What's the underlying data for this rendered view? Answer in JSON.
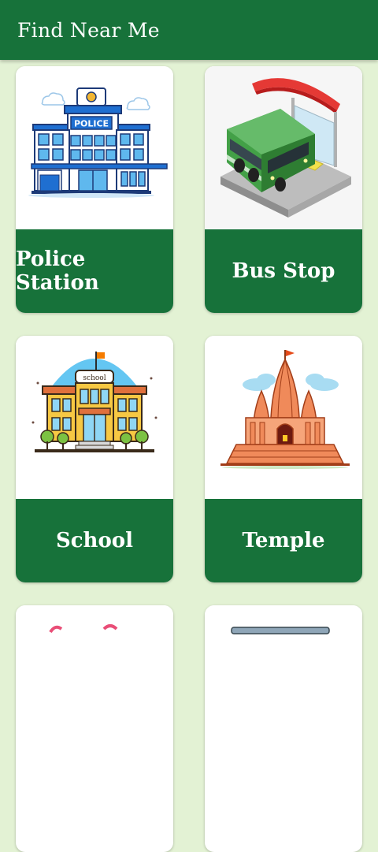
{
  "app_bar": {
    "title": "Find Near Me"
  },
  "colors": {
    "primary": "#17723a",
    "background": "#e3f2d4",
    "card": "#ffffff"
  },
  "categories": [
    {
      "label": "Police Station",
      "icon": "police-station-icon",
      "sign": "POLICE"
    },
    {
      "label": "Bus Stop",
      "icon": "bus-stop-icon"
    },
    {
      "label": "School",
      "icon": "school-icon",
      "sign": "school"
    },
    {
      "label": "Temple",
      "icon": "temple-icon"
    },
    {
      "label": "",
      "icon": "partial-card-icon"
    },
    {
      "label": "",
      "icon": "partial-card-icon"
    }
  ]
}
